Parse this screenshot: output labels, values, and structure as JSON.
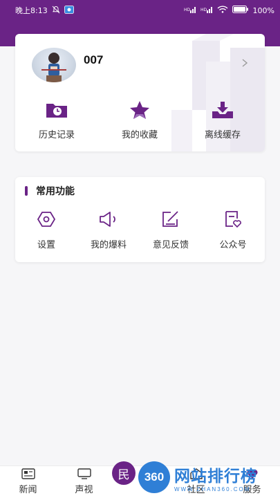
{
  "status_bar": {
    "time": "晚上8:13",
    "battery": "100%"
  },
  "profile": {
    "username": "007"
  },
  "quick_actions": [
    {
      "label": "历史记录",
      "icon": "history-icon"
    },
    {
      "label": "我的收藏",
      "icon": "star-icon"
    },
    {
      "label": "离线缓存",
      "icon": "download-tray-icon"
    }
  ],
  "functions": {
    "title": "常用功能",
    "items": [
      {
        "label": "设置",
        "icon": "settings-hexagon-icon"
      },
      {
        "label": "我的爆料",
        "icon": "speaker-icon"
      },
      {
        "label": "意见反馈",
        "icon": "edit-icon"
      },
      {
        "label": "公众号",
        "icon": "heart-card-icon"
      }
    ]
  },
  "tab_bar": {
    "tabs": [
      {
        "label": "新闻",
        "icon": "news-icon"
      },
      {
        "label": "声视",
        "icon": "tv-icon"
      },
      {
        "label": "民",
        "icon": "center-icon"
      },
      {
        "label": "社区",
        "icon": "community-icon"
      },
      {
        "label": "服务",
        "icon": "service-icon"
      }
    ]
  },
  "watermark": {
    "badge": "360",
    "title": "网站排行榜",
    "subtitle": "WWW.ZHAN360.COM"
  },
  "colors": {
    "brand": "#6a2386",
    "watermark": "#2f7fd6"
  }
}
